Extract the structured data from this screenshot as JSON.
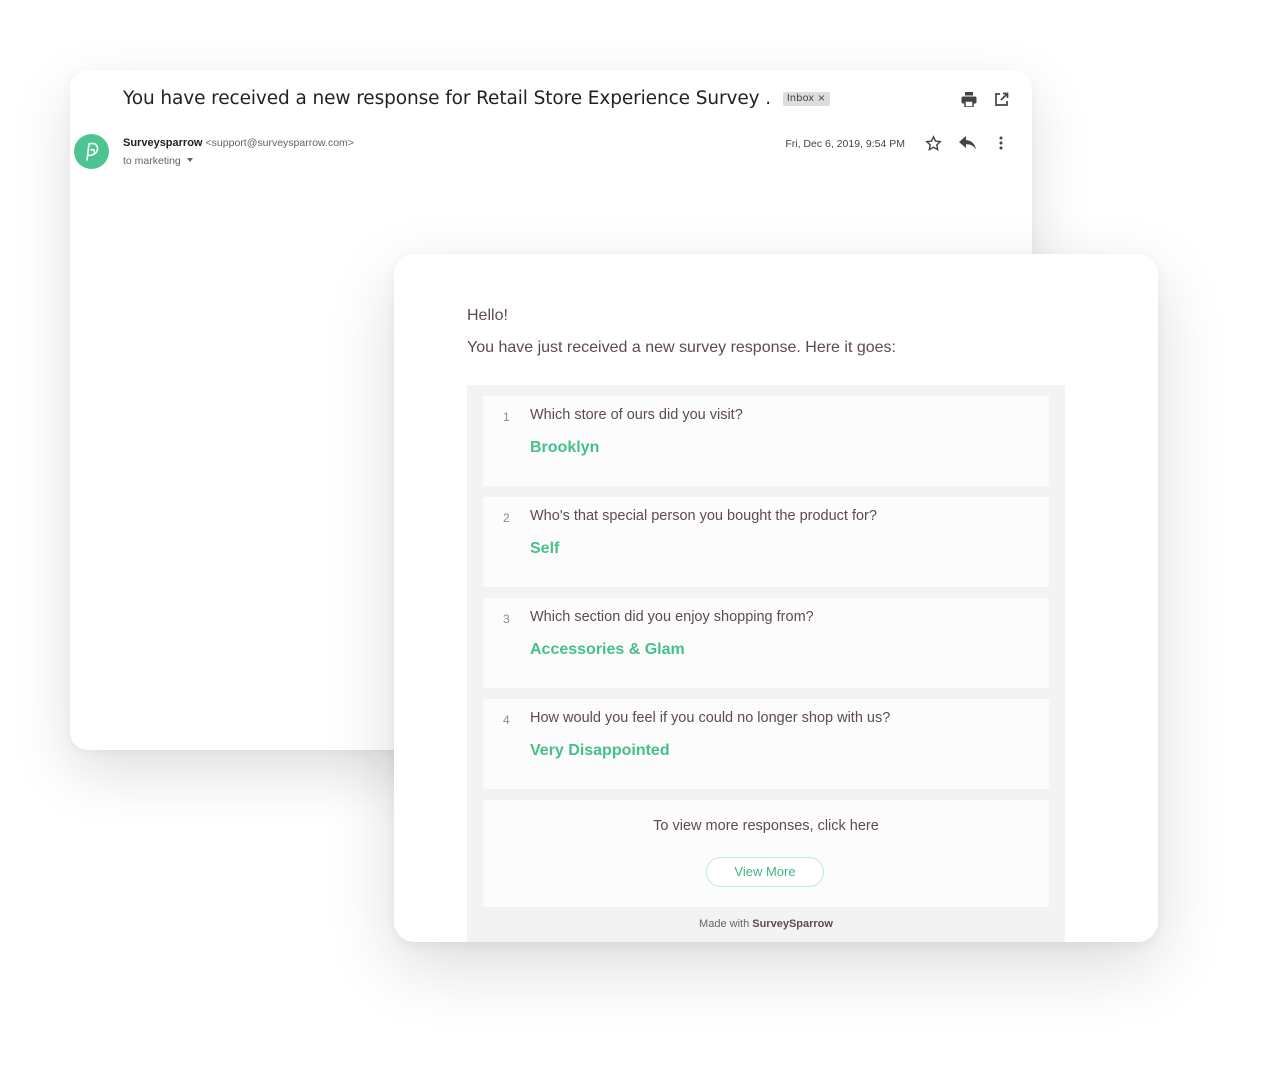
{
  "email": {
    "subject": "You have received a new response for Retail Store Experience Survey .",
    "label_chip": "Inbox",
    "label_chip_close": "×",
    "sender_name": "Surveysparrow",
    "sender_email": "<support@surveysparrow.com>",
    "recipient": "to marketing",
    "date": "Fri, Dec 6, 2019, 9:54 PM",
    "icons": [
      "print-icon",
      "open-in-new-icon",
      "star-icon",
      "reply-icon",
      "more-vert-icon"
    ],
    "avatar_color": "#4cc592"
  },
  "survey": {
    "greeting": "Hello!",
    "intro": "You have just received a new survey response. Here it goes:",
    "responses": [
      {
        "num": "1",
        "question": "Which store of ours did you visit?",
        "answer": "Brooklyn"
      },
      {
        "num": "2",
        "question": "Who's that special person you bought the product for?",
        "answer": "Self"
      },
      {
        "num": "3",
        "question": "Which section did you enjoy shopping from?",
        "answer": "Accessories & Glam"
      },
      {
        "num": "4",
        "question": "How would you feel if you could no longer shop with us?",
        "answer": "Very Disappointed"
      }
    ],
    "more_text": "To view more responses, click here",
    "view_more_label": "View More",
    "footer_prefix": "Made with",
    "footer_brand": "SurveySparrow",
    "accent_color": "#46c08b",
    "text_color": "#5d4a57"
  }
}
